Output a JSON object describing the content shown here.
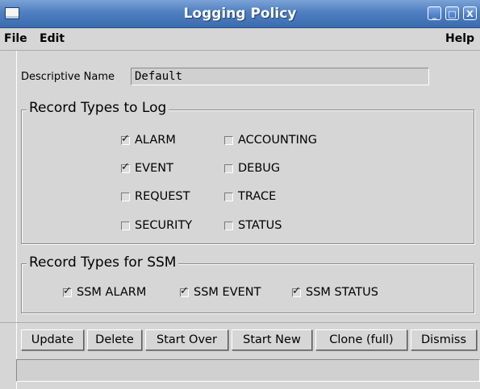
{
  "window": {
    "title": "Logging Policy",
    "buttons": {
      "minimize": "_",
      "maximize": "□",
      "close": "X"
    }
  },
  "menubar": {
    "file": "File",
    "edit": "Edit",
    "help": "Help"
  },
  "form": {
    "descriptive_name_label": "Descriptive Name",
    "descriptive_name_value": "Default"
  },
  "record_types": {
    "legend": "Record Types to Log",
    "items": [
      {
        "label": "ALARM",
        "checked": true
      },
      {
        "label": "ACCOUNTING",
        "checked": false
      },
      {
        "label": "EVENT",
        "checked": true
      },
      {
        "label": "DEBUG",
        "checked": false
      },
      {
        "label": "REQUEST",
        "checked": false
      },
      {
        "label": "TRACE",
        "checked": false
      },
      {
        "label": "SECURITY",
        "checked": false
      },
      {
        "label": "STATUS",
        "checked": false
      }
    ]
  },
  "ssm_types": {
    "legend": "Record Types for SSM",
    "items": [
      {
        "label": "SSM ALARM",
        "checked": true
      },
      {
        "label": "SSM EVENT",
        "checked": true
      },
      {
        "label": "SSM STATUS",
        "checked": true
      }
    ]
  },
  "actions": {
    "update": "Update",
    "delete": "Delete",
    "start_over": "Start Over",
    "start_new": "Start New",
    "clone_full": "Clone (full)",
    "dismiss": "Dismiss"
  },
  "status_bar": {
    "text": ""
  },
  "icons": {
    "window": "window-icon",
    "minimize": "minimize-icon",
    "maximize": "maximize-icon",
    "close": "close-icon",
    "check": "check-mark-icon"
  },
  "colors": {
    "titlebar": "#4f7fc0",
    "background": "#d6d6d6"
  }
}
